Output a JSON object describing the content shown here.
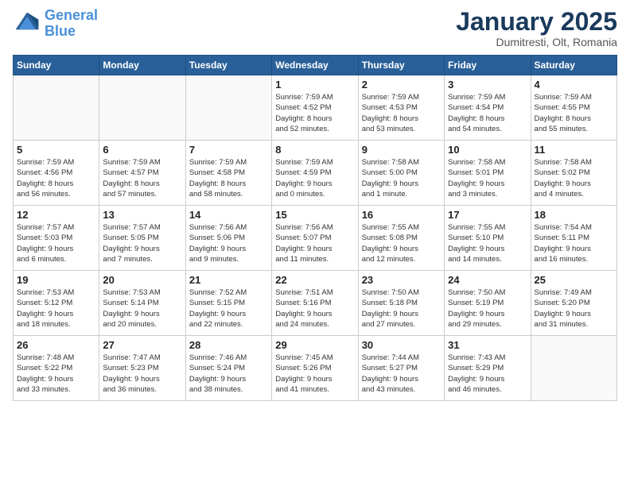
{
  "header": {
    "logo_line1": "General",
    "logo_line2": "Blue",
    "month": "January 2025",
    "location": "Dumitresti, Olt, Romania"
  },
  "weekdays": [
    "Sunday",
    "Monday",
    "Tuesday",
    "Wednesday",
    "Thursday",
    "Friday",
    "Saturday"
  ],
  "weeks": [
    [
      {
        "day": "",
        "info": ""
      },
      {
        "day": "",
        "info": ""
      },
      {
        "day": "",
        "info": ""
      },
      {
        "day": "1",
        "info": "Sunrise: 7:59 AM\nSunset: 4:52 PM\nDaylight: 8 hours\nand 52 minutes."
      },
      {
        "day": "2",
        "info": "Sunrise: 7:59 AM\nSunset: 4:53 PM\nDaylight: 8 hours\nand 53 minutes."
      },
      {
        "day": "3",
        "info": "Sunrise: 7:59 AM\nSunset: 4:54 PM\nDaylight: 8 hours\nand 54 minutes."
      },
      {
        "day": "4",
        "info": "Sunrise: 7:59 AM\nSunset: 4:55 PM\nDaylight: 8 hours\nand 55 minutes."
      }
    ],
    [
      {
        "day": "5",
        "info": "Sunrise: 7:59 AM\nSunset: 4:56 PM\nDaylight: 8 hours\nand 56 minutes."
      },
      {
        "day": "6",
        "info": "Sunrise: 7:59 AM\nSunset: 4:57 PM\nDaylight: 8 hours\nand 57 minutes."
      },
      {
        "day": "7",
        "info": "Sunrise: 7:59 AM\nSunset: 4:58 PM\nDaylight: 8 hours\nand 58 minutes."
      },
      {
        "day": "8",
        "info": "Sunrise: 7:59 AM\nSunset: 4:59 PM\nDaylight: 9 hours\nand 0 minutes."
      },
      {
        "day": "9",
        "info": "Sunrise: 7:58 AM\nSunset: 5:00 PM\nDaylight: 9 hours\nand 1 minute."
      },
      {
        "day": "10",
        "info": "Sunrise: 7:58 AM\nSunset: 5:01 PM\nDaylight: 9 hours\nand 3 minutes."
      },
      {
        "day": "11",
        "info": "Sunrise: 7:58 AM\nSunset: 5:02 PM\nDaylight: 9 hours\nand 4 minutes."
      }
    ],
    [
      {
        "day": "12",
        "info": "Sunrise: 7:57 AM\nSunset: 5:03 PM\nDaylight: 9 hours\nand 6 minutes."
      },
      {
        "day": "13",
        "info": "Sunrise: 7:57 AM\nSunset: 5:05 PM\nDaylight: 9 hours\nand 7 minutes."
      },
      {
        "day": "14",
        "info": "Sunrise: 7:56 AM\nSunset: 5:06 PM\nDaylight: 9 hours\nand 9 minutes."
      },
      {
        "day": "15",
        "info": "Sunrise: 7:56 AM\nSunset: 5:07 PM\nDaylight: 9 hours\nand 11 minutes."
      },
      {
        "day": "16",
        "info": "Sunrise: 7:55 AM\nSunset: 5:08 PM\nDaylight: 9 hours\nand 12 minutes."
      },
      {
        "day": "17",
        "info": "Sunrise: 7:55 AM\nSunset: 5:10 PM\nDaylight: 9 hours\nand 14 minutes."
      },
      {
        "day": "18",
        "info": "Sunrise: 7:54 AM\nSunset: 5:11 PM\nDaylight: 9 hours\nand 16 minutes."
      }
    ],
    [
      {
        "day": "19",
        "info": "Sunrise: 7:53 AM\nSunset: 5:12 PM\nDaylight: 9 hours\nand 18 minutes."
      },
      {
        "day": "20",
        "info": "Sunrise: 7:53 AM\nSunset: 5:14 PM\nDaylight: 9 hours\nand 20 minutes."
      },
      {
        "day": "21",
        "info": "Sunrise: 7:52 AM\nSunset: 5:15 PM\nDaylight: 9 hours\nand 22 minutes."
      },
      {
        "day": "22",
        "info": "Sunrise: 7:51 AM\nSunset: 5:16 PM\nDaylight: 9 hours\nand 24 minutes."
      },
      {
        "day": "23",
        "info": "Sunrise: 7:50 AM\nSunset: 5:18 PM\nDaylight: 9 hours\nand 27 minutes."
      },
      {
        "day": "24",
        "info": "Sunrise: 7:50 AM\nSunset: 5:19 PM\nDaylight: 9 hours\nand 29 minutes."
      },
      {
        "day": "25",
        "info": "Sunrise: 7:49 AM\nSunset: 5:20 PM\nDaylight: 9 hours\nand 31 minutes."
      }
    ],
    [
      {
        "day": "26",
        "info": "Sunrise: 7:48 AM\nSunset: 5:22 PM\nDaylight: 9 hours\nand 33 minutes."
      },
      {
        "day": "27",
        "info": "Sunrise: 7:47 AM\nSunset: 5:23 PM\nDaylight: 9 hours\nand 36 minutes."
      },
      {
        "day": "28",
        "info": "Sunrise: 7:46 AM\nSunset: 5:24 PM\nDaylight: 9 hours\nand 38 minutes."
      },
      {
        "day": "29",
        "info": "Sunrise: 7:45 AM\nSunset: 5:26 PM\nDaylight: 9 hours\nand 41 minutes."
      },
      {
        "day": "30",
        "info": "Sunrise: 7:44 AM\nSunset: 5:27 PM\nDaylight: 9 hours\nand 43 minutes."
      },
      {
        "day": "31",
        "info": "Sunrise: 7:43 AM\nSunset: 5:29 PM\nDaylight: 9 hours\nand 46 minutes."
      },
      {
        "day": "",
        "info": ""
      }
    ]
  ]
}
